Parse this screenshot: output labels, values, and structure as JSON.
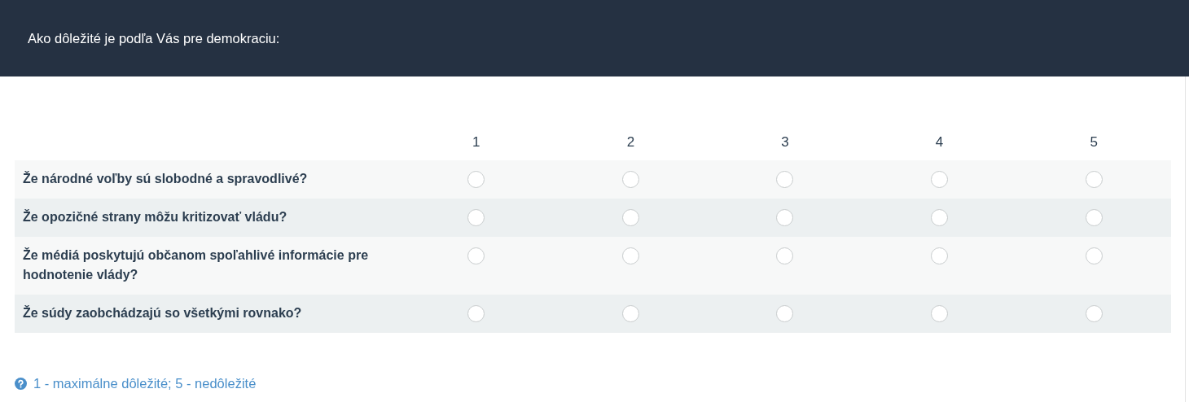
{
  "header": {
    "title": "Ako dôležité je podľa Vás pre demokraciu:"
  },
  "table": {
    "columns": [
      "1",
      "2",
      "3",
      "4",
      "5"
    ],
    "rows": [
      {
        "label": "Že národné voľby sú slobodné a spravodlivé?",
        "options": [
          {
            "selected": false
          },
          {
            "selected": false
          },
          {
            "selected": false
          },
          {
            "selected": false
          },
          {
            "selected": false
          }
        ]
      },
      {
        "label": "Že opozičné strany môžu kritizovať vládu?",
        "options": [
          {
            "selected": false
          },
          {
            "selected": false
          },
          {
            "selected": false
          },
          {
            "selected": false
          },
          {
            "selected": false
          }
        ]
      },
      {
        "label": "Že médiá poskytujú občanom spoľahlivé informácie pre hodnotenie vlády?",
        "options": [
          {
            "selected": false
          },
          {
            "selected": false
          },
          {
            "selected": false
          },
          {
            "selected": false
          },
          {
            "selected": false
          }
        ]
      },
      {
        "label": "Že súdy zaobchádzajú so všetkými rovnako?",
        "options": [
          {
            "selected": false
          },
          {
            "selected": false
          },
          {
            "selected": false
          },
          {
            "selected": false
          },
          {
            "selected": false
          }
        ]
      }
    ]
  },
  "hint": "1 - maximálne dôležité; 5 - nedôležité"
}
